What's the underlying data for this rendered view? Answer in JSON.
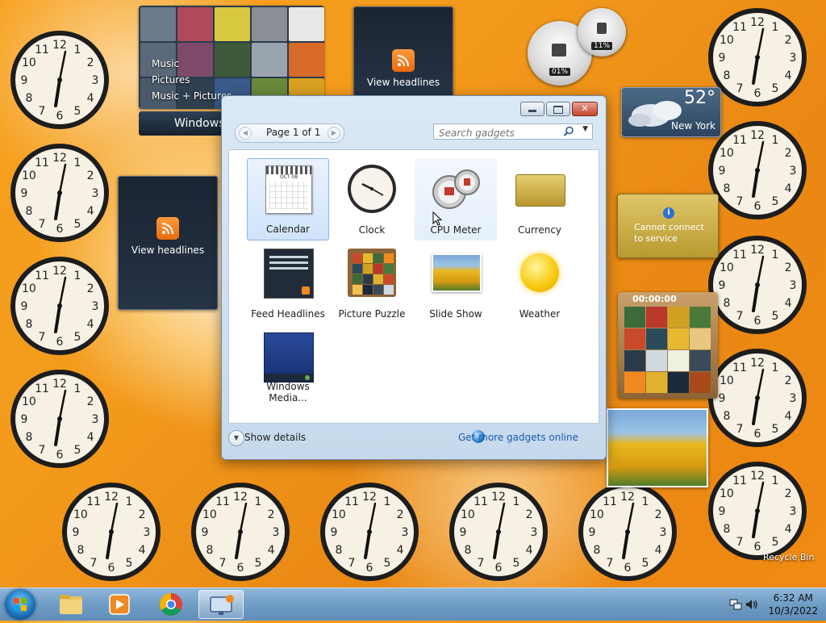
{
  "desktop": {
    "media_center": {
      "menu": [
        "Music",
        "Pictures",
        "Music + Pictures"
      ],
      "bar_label": "Windows"
    },
    "feed_headlines_top": {
      "label": "View headlines"
    },
    "feed_headlines_left": {
      "label": "View headlines"
    },
    "cpu_meter": {
      "cpu": "01%",
      "memory": "11%"
    },
    "weather": {
      "temperature": "52°",
      "city": "New York"
    },
    "currency": {
      "message": "Cannot connect to service"
    },
    "puzzle": {
      "timer": "00:00:00"
    },
    "recycle_bin": {
      "label": "Recycle Bin"
    }
  },
  "gadgets_window": {
    "pagination": {
      "label": "Page 1 of 1"
    },
    "search": {
      "placeholder": "Search gadgets"
    },
    "gadgets": [
      {
        "name": "Calendar",
        "state": "selected"
      },
      {
        "name": "Clock",
        "state": "normal"
      },
      {
        "name": "CPU Meter",
        "state": "hover"
      },
      {
        "name": "Currency",
        "state": "normal"
      },
      {
        "name": "Feed Headlines",
        "state": "normal"
      },
      {
        "name": "Picture Puzzle",
        "state": "normal"
      },
      {
        "name": "Slide Show",
        "state": "normal"
      },
      {
        "name": "Weather",
        "state": "normal"
      },
      {
        "name": "Windows Media...",
        "state": "normal"
      }
    ],
    "calendar_icon_month": "OCT 08",
    "show_details": "Show details",
    "get_more": "Get more gadgets online"
  },
  "taskbar": {
    "time": "6:32 AM",
    "date": "10/3/2022",
    "buttons": [
      "start-button",
      "file-explorer",
      "media-player",
      "chrome",
      "gadgets-window"
    ]
  },
  "colors": {
    "accent": "#1c5ab4",
    "desktop_orange": "#f39a1c",
    "taskbar_blue": "#6f9dc6"
  }
}
